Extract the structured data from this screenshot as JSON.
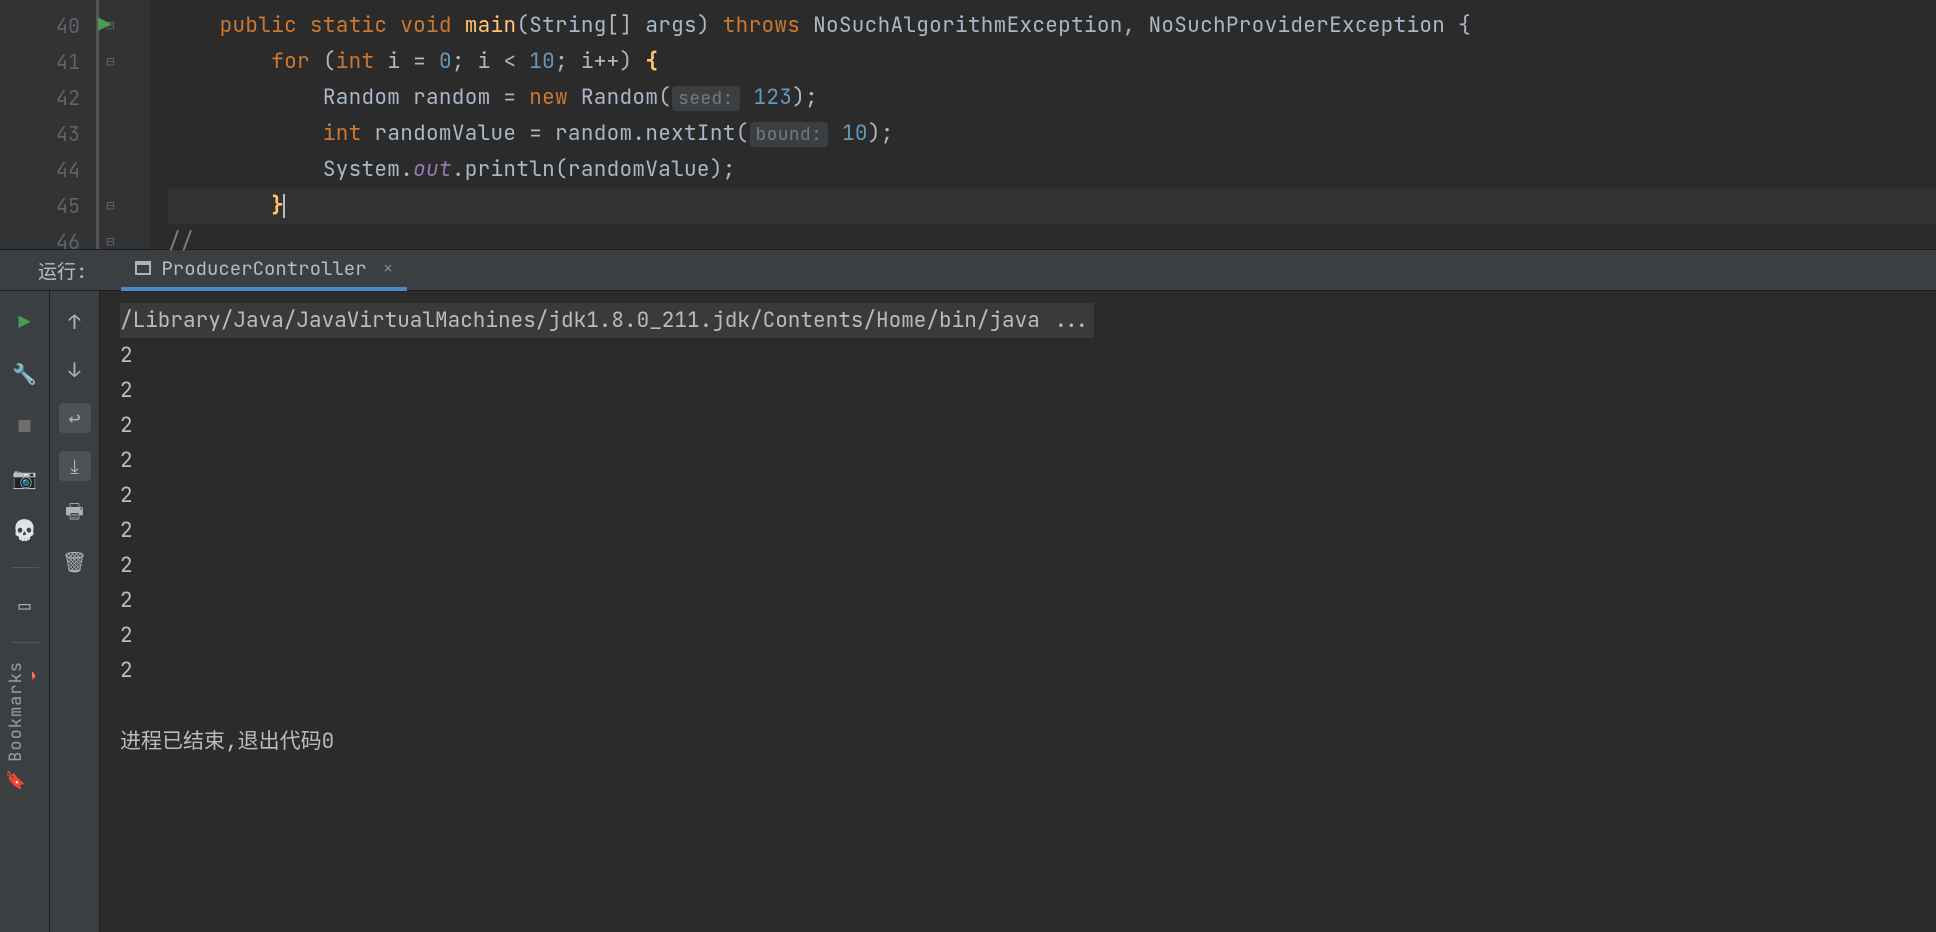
{
  "editor": {
    "line_numbers": [
      "40",
      "41",
      "42",
      "43",
      "44",
      "45",
      "46"
    ],
    "code": {
      "l40": {
        "public": "public",
        "static": "static",
        "void": "void",
        "main": "main",
        "sig1": "(String[] args)",
        "throws": "throws",
        "exc": "NoSuchAlgorithmException, NoSuchProviderException {"
      },
      "l41": {
        "for": "for",
        "p1": "(",
        "int": "int",
        "i": "i = ",
        "z": "0",
        "semi1": "; i < ",
        "ten": "10",
        "semi2": "; i++) ",
        "brace": "{"
      },
      "l42": {
        "t1": "Random random = ",
        "new": "new",
        "t2": " Random(",
        "hint": "seed:",
        "v": " 123",
        "t3": ");"
      },
      "l43": {
        "int": "int",
        "t1": " randomValue = random.nextInt(",
        "hint": "bound:",
        "v": " 10",
        "t2": ");"
      },
      "l44": {
        "t1": "System.",
        "out": "out",
        "t2": ".println(randomValue);"
      },
      "l45": {
        "brace": "}"
      },
      "l46": {
        "cmt": "//"
      }
    }
  },
  "runpanel": {
    "label": "运行:",
    "tab_name": "ProducerController",
    "tab_close": "×"
  },
  "console": {
    "cmd": "/Library/Java/JavaVirtualMachines/jdk1.8.0_211.jdk/Contents/Home/bin/java ...",
    "output_lines": [
      "2",
      "2",
      "2",
      "2",
      "2",
      "2",
      "2",
      "2",
      "2",
      "2"
    ],
    "exit_msg": "进程已结束,退出代码0"
  },
  "sidebar": {
    "bookmarks": "Bookmarks"
  }
}
